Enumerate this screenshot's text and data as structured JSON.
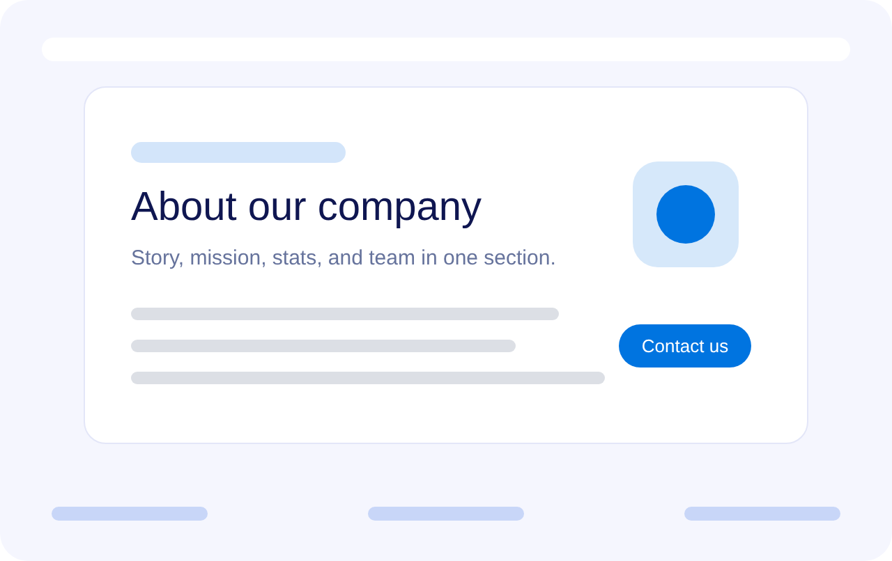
{
  "section": {
    "title": "About our company",
    "subtitle": "Story, mission, stats, and team in one section.",
    "button": "Contact us"
  }
}
